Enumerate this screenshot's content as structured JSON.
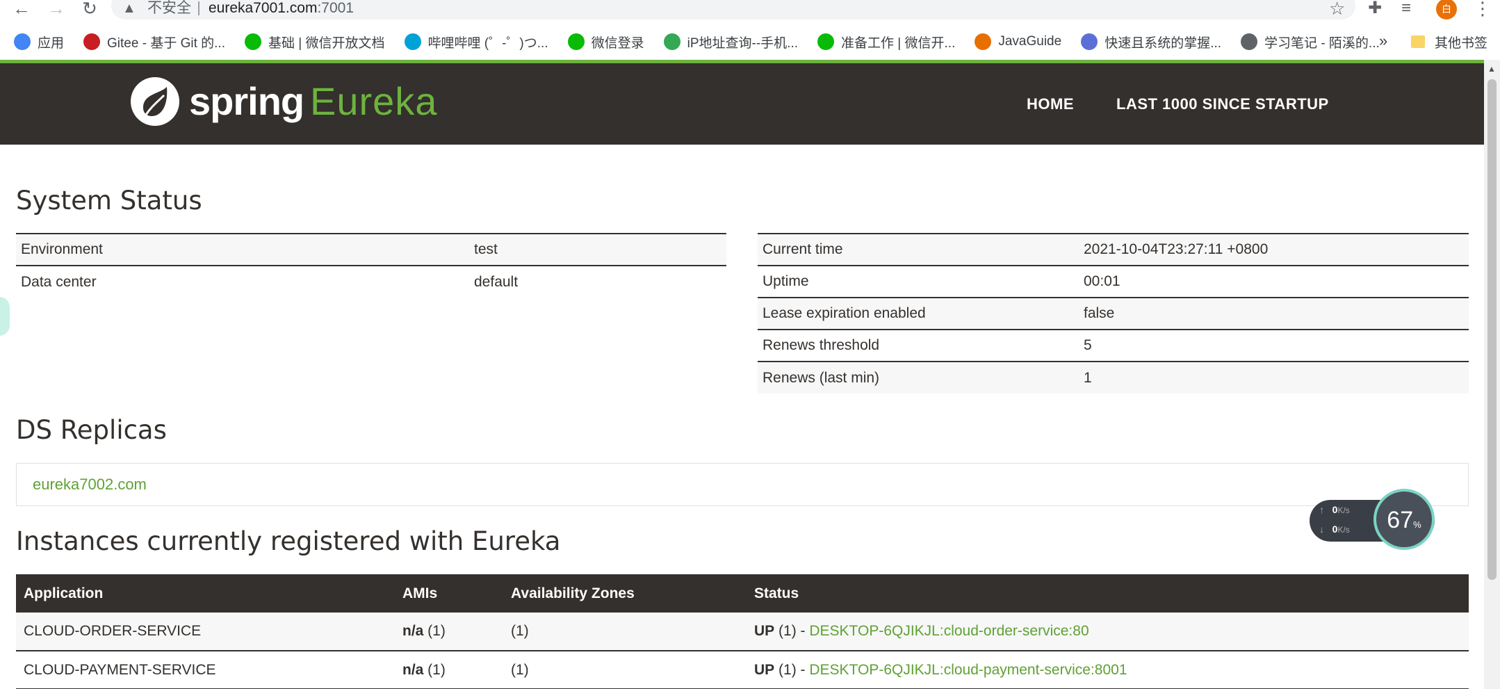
{
  "browser": {
    "insecure_label": "不安全",
    "url_host": "eureka7001.com",
    "url_port": ":7001",
    "avatar_letter": "白",
    "bookmarks": [
      {
        "label": "应用",
        "icon": "apps-grid-icon",
        "color": "#4285f4"
      },
      {
        "label": "Gitee - 基于 Git 的...",
        "icon": "gitee-icon",
        "color": "#c71d23"
      },
      {
        "label": "基础 | 微信开放文档",
        "icon": "wechat-icon",
        "color": "#09bb07"
      },
      {
        "label": "哔哩哔哩 (゜-゜)つ...",
        "icon": "bilibili-icon",
        "color": "#00a1d6"
      },
      {
        "label": "微信登录",
        "icon": "wechat-icon",
        "color": "#09bb07"
      },
      {
        "label": "iP地址查询--手机...",
        "icon": "ip-query-icon",
        "color": "#34a853"
      },
      {
        "label": "准备工作 | 微信开...",
        "icon": "wechat-icon",
        "color": "#09bb07"
      },
      {
        "label": "JavaGuide",
        "icon": "javaguide-icon",
        "color": "#e76f00"
      },
      {
        "label": "快速且系统的掌握...",
        "icon": "site-icon",
        "color": "#5b6fd6"
      },
      {
        "label": "学习笔记 - 陌溪的...",
        "icon": "globe-icon",
        "color": "#5f6368"
      }
    ],
    "more_label": "»",
    "other_bookmarks": "其他书签"
  },
  "navbar": {
    "logo_spring": "spring",
    "logo_eureka": "Eureka",
    "home": "HOME",
    "last1000": "LAST 1000 SINCE STARTUP"
  },
  "system_status": {
    "title": "System Status",
    "left": [
      {
        "key": "Environment",
        "value": "test"
      },
      {
        "key": "Data center",
        "value": "default"
      }
    ],
    "right": [
      {
        "key": "Current time",
        "value": "2021-10-04T23:27:11 +0800"
      },
      {
        "key": "Uptime",
        "value": "00:01"
      },
      {
        "key": "Lease expiration enabled",
        "value": "false"
      },
      {
        "key": "Renews threshold",
        "value": "5"
      },
      {
        "key": "Renews (last min)",
        "value": "1"
      }
    ]
  },
  "ds_replicas": {
    "title": "DS Replicas",
    "replica": "eureka7002.com"
  },
  "instances": {
    "title": "Instances currently registered with Eureka",
    "headers": [
      "Application",
      "AMIs",
      "Availability Zones",
      "Status"
    ],
    "rows": [
      {
        "application": "CLOUD-ORDER-SERVICE",
        "amis_bold": "n/a",
        "amis_count": " (1)",
        "zones": "(1)",
        "status_prefix": "UP",
        "status_count": " (1) - ",
        "status_link": "DESKTOP-6QJIKJL:cloud-order-service:80"
      },
      {
        "application": "CLOUD-PAYMENT-SERVICE",
        "amis_bold": "n/a",
        "amis_count": " (1)",
        "zones": "(1)",
        "status_prefix": "UP",
        "status_count": " (1) - ",
        "status_link": "DESKTOP-6QJIKJL:cloud-payment-service:8001"
      }
    ]
  },
  "speed_widget": {
    "upload": "0",
    "download": "0",
    "unit": "K/s",
    "percent": "67",
    "percent_sign": "%"
  }
}
